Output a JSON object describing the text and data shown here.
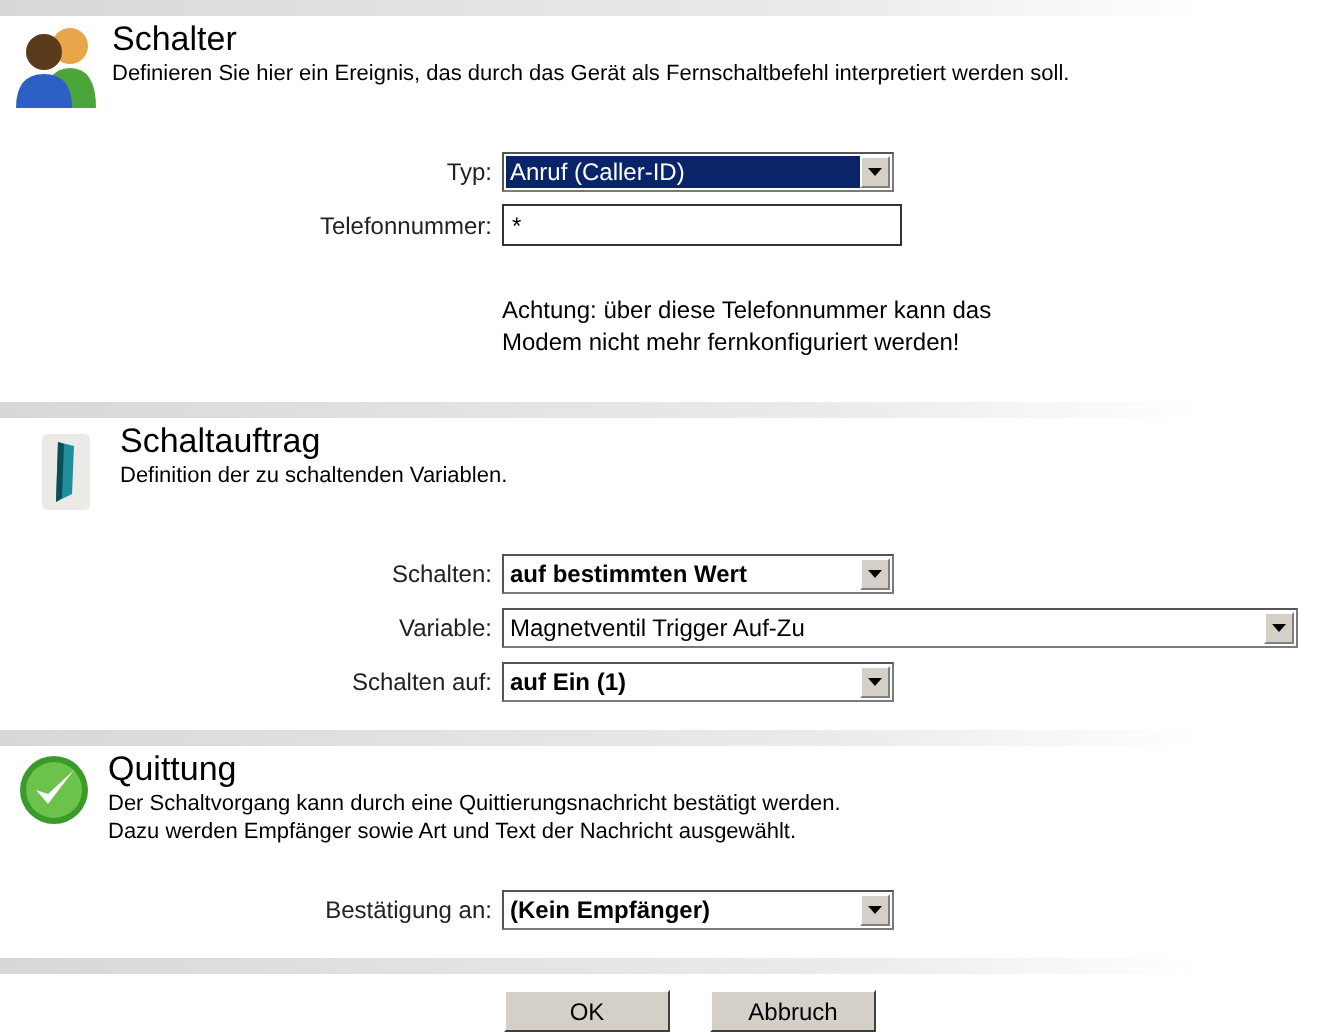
{
  "sections": [
    {
      "kind": "people",
      "title": "Schalter",
      "description": [
        "Definieren Sie hier ein Ereignis, das durch das Gerät als Fernschaltbefehl interpretiert werden soll."
      ],
      "fields": [
        {
          "kind": "select",
          "label": "Typ:",
          "value": "Anruf (Caller-ID)",
          "bold": false,
          "focused": true,
          "wide": false
        },
        {
          "kind": "text",
          "label": "Telefonnummer:",
          "value": "*"
        }
      ],
      "note": [
        "Achtung: über diese Telefonnummer kann das",
        "Modem nicht mehr fernkonfiguriert werden!"
      ]
    },
    {
      "kind": "switch",
      "title": "Schaltauftrag",
      "description": [
        "Definition der zu schaltenden Variablen."
      ],
      "fields": [
        {
          "kind": "select",
          "label": "Schalten:",
          "value": "auf bestimmten Wert",
          "bold": true,
          "focused": false,
          "wide": false
        },
        {
          "kind": "select",
          "label": "Variable:",
          "value": "Magnetventil Trigger Auf-Zu",
          "bold": false,
          "focused": false,
          "wide": true
        },
        {
          "kind": "select",
          "label": "Schalten auf:",
          "value": "auf Ein (1)",
          "bold": true,
          "focused": false,
          "wide": false
        }
      ]
    },
    {
      "kind": "check",
      "title": "Quittung",
      "description": [
        "Der Schaltvorgang kann durch eine Quittierungsnachricht bestätigt werden.",
        "Dazu werden Empfänger sowie Art und Text der Nachricht ausgewählt."
      ],
      "fields": [
        {
          "kind": "select",
          "label": "Bestätigung an:",
          "value": "(Kein Empfänger)",
          "bold": true,
          "focused": false,
          "wide": false
        }
      ]
    }
  ],
  "buttons": [
    "OK",
    "Abbruch"
  ]
}
